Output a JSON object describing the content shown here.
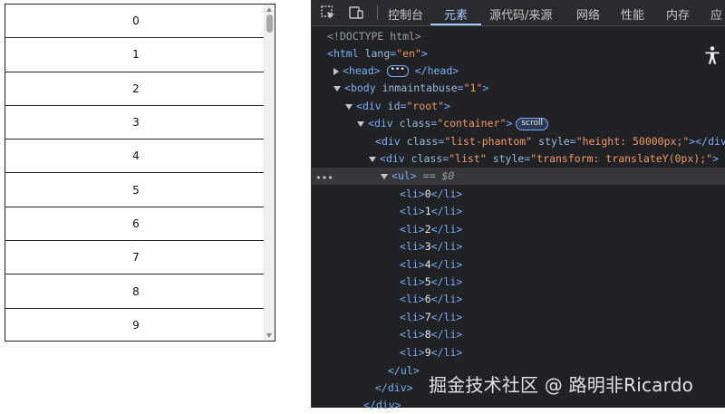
{
  "list": {
    "items": [
      "0",
      "1",
      "2",
      "3",
      "4",
      "5",
      "6",
      "7",
      "8",
      "9"
    ]
  },
  "devtools": {
    "tabs": [
      "控制台",
      "元素",
      "源代码/来源",
      "网络",
      "性能",
      "内存",
      "应"
    ],
    "active_tab": "元素",
    "icons": [
      "inspect-element-icon",
      "device-toolbar-icon",
      "accessibility-icon"
    ],
    "dom": {
      "doctype": "<!DOCTYPE html>",
      "html_tag": "html",
      "lang_attr": "lang",
      "lang_val": "\"en\"",
      "head_tag": "head",
      "head_close": "</head>",
      "ellipsis": "•••",
      "body_tag": "body",
      "body_attr": "inmaintabuse",
      "body_val": "\"1\"",
      "div_tag": "div",
      "id_attr": "id",
      "root_val": "\"root\"",
      "class_attr": "class",
      "container_val": "\"container\"",
      "scroll_badge": "scroll",
      "phantom_val": "\"list-phantom\"",
      "style_attr": "style",
      "phantom_style": "\"height: 50000px;\"",
      "div_close": "</div>",
      "list_val": "\"list\"",
      "list_style": "\"transform: translateY(0px);\"",
      "ul_tag": "ul",
      "selected_marker": "== $0",
      "li_tag": "li",
      "li_items": [
        "0",
        "1",
        "2",
        "3",
        "4",
        "5",
        "6",
        "7",
        "8",
        "9"
      ],
      "ul_close": "</ul>",
      "row_dots": "•••"
    },
    "colors": {
      "background": "#202124",
      "toolbar": "#292a2d",
      "tag": "#7cacf8",
      "attribute_value": "#f29766",
      "active_tab": "#a8c7fa"
    }
  },
  "watermark": "掘金技术社区 @ 路明非Ricardo"
}
